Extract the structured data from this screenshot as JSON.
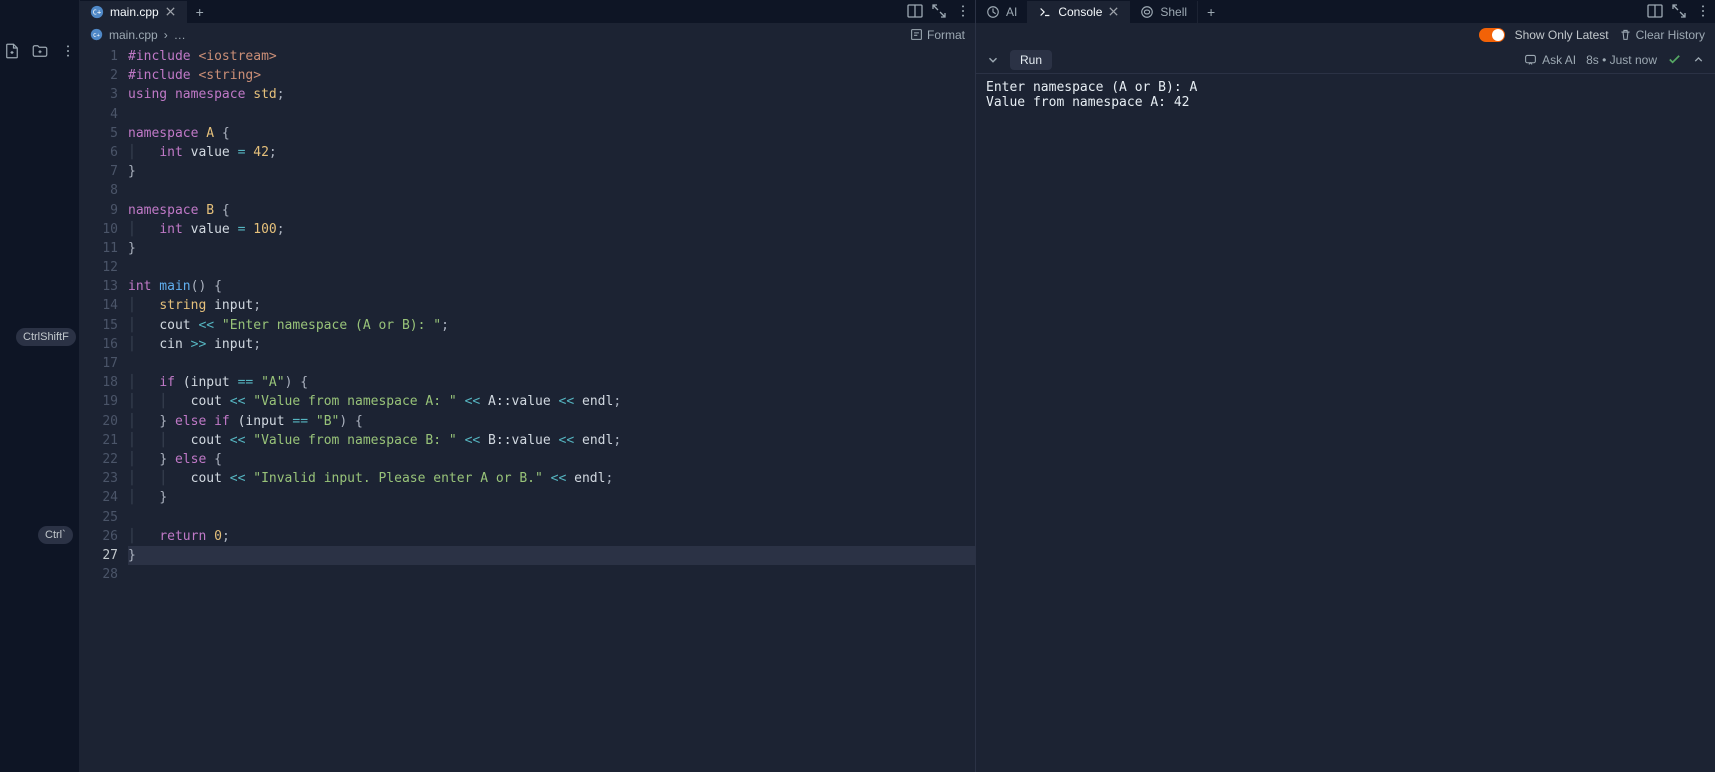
{
  "editor": {
    "tab": {
      "filename": "main.cpp"
    },
    "breadcrumb": {
      "filename": "main.cpp",
      "more": "…"
    },
    "format_label": "Format",
    "line_count": 28,
    "highlighted_line": 27
  },
  "code": {
    "l1_a": "#include",
    "l1_b": " <iostream>",
    "l2_a": "#include",
    "l2_b": " <string>",
    "l3_a": "using",
    "l3_b": " namespace",
    "l3_c": " std",
    "l3_d": ";",
    "l5_a": "namespace",
    "l5_b": " A",
    "l5_c": " {",
    "l6_a": "int",
    "l6_b": " value ",
    "l6_c": "=",
    "l6_d": " 42",
    "l6_e": ";",
    "l7": "}",
    "l9_a": "namespace",
    "l9_b": " B",
    "l9_c": " {",
    "l10_a": "int",
    "l10_b": " value ",
    "l10_c": "=",
    "l10_d": " 100",
    "l10_e": ";",
    "l11": "}",
    "l13_a": "int",
    "l13_b": " main",
    "l13_c": "() {",
    "l14_a": "string",
    "l14_b": " input",
    "l14_c": ";",
    "l15_a": "cout ",
    "l15_b": "<<",
    "l15_c": " \"Enter namespace (A or B): \"",
    "l15_d": ";",
    "l16_a": "cin ",
    "l16_b": ">>",
    "l16_c": " input",
    "l16_d": ";",
    "l18_a": "if",
    "l18_b": " (input ",
    "l18_c": "==",
    "l18_d": " \"A\"",
    "l18_e": ") {",
    "l19_a": "cout ",
    "l19_b": "<<",
    "l19_c": " \"Value from namespace A: \"",
    "l19_d": " <<",
    "l19_e": " A::value ",
    "l19_f": "<<",
    "l19_g": " endl",
    "l19_h": ";",
    "l20_a": "} ",
    "l20_b": "else",
    "l20_c": " if",
    "l20_d": " (input ",
    "l20_e": "==",
    "l20_f": " \"B\"",
    "l20_g": ") {",
    "l21_a": "cout ",
    "l21_b": "<<",
    "l21_c": " \"Value from namespace B: \"",
    "l21_d": " <<",
    "l21_e": " B::value ",
    "l21_f": "<<",
    "l21_g": " endl",
    "l21_h": ";",
    "l22_a": "} ",
    "l22_b": "else",
    "l22_c": " {",
    "l23_a": "cout ",
    "l23_b": "<<",
    "l23_c": " \"Invalid input. Please enter A or B.\"",
    "l23_d": " <<",
    "l23_e": " endl",
    "l23_f": ";",
    "l24": "}",
    "l26_a": "return",
    "l26_b": " 0",
    "l26_c": ";",
    "l27": "}"
  },
  "right": {
    "tabs": {
      "ai": "AI",
      "console": "Console",
      "shell": "Shell"
    },
    "show_only_latest": "Show Only Latest",
    "clear_history": "Clear History",
    "run_label": "Run",
    "ask_ai": "Ask AI",
    "timestamp": "8s • Just now"
  },
  "console_output": "Enter namespace (A or B): A\nValue from namespace A: 42",
  "shortcuts": {
    "find": "CtrlShiftF",
    "terminal": "Ctrl`"
  }
}
